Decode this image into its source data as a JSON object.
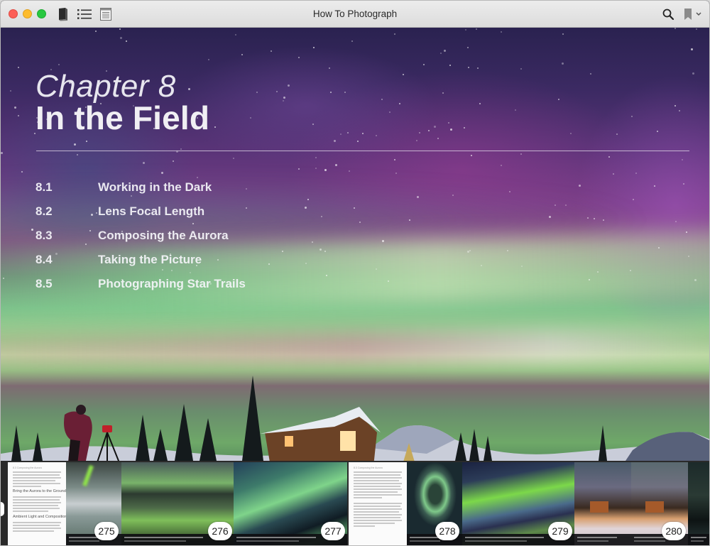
{
  "window": {
    "title": "How To Photograph",
    "toolbar": {
      "library_icon": "book-icon",
      "toc_icon": "list-icon",
      "notes_icon": "notes-icon",
      "search_icon": "search-icon",
      "bookmark_icon": "bookmark-icon"
    }
  },
  "chapter": {
    "kicker": "Chapter 8",
    "title": "In the Field",
    "sections": [
      {
        "number": "8.1",
        "label": "Working in the Dark"
      },
      {
        "number": "8.2",
        "label": "Lens Focal Length"
      },
      {
        "number": "8.3",
        "label": "Composing the Aurora"
      },
      {
        "number": "8.4",
        "label": "Taking the Picture"
      },
      {
        "number": "8.5",
        "label": "Photographing Star Trails"
      }
    ]
  },
  "thumbnails": {
    "text_page_1": {
      "header": "8.3 Composing the Aurora",
      "heading_1": "Bring the Aurora to the Ground",
      "heading_2": "Ambient Light and Composition"
    },
    "text_page_2": {
      "header": "8.3 Composing the Aurora"
    },
    "page_numbers": [
      "275",
      "276",
      "277",
      "278",
      "279",
      "280"
    ]
  }
}
